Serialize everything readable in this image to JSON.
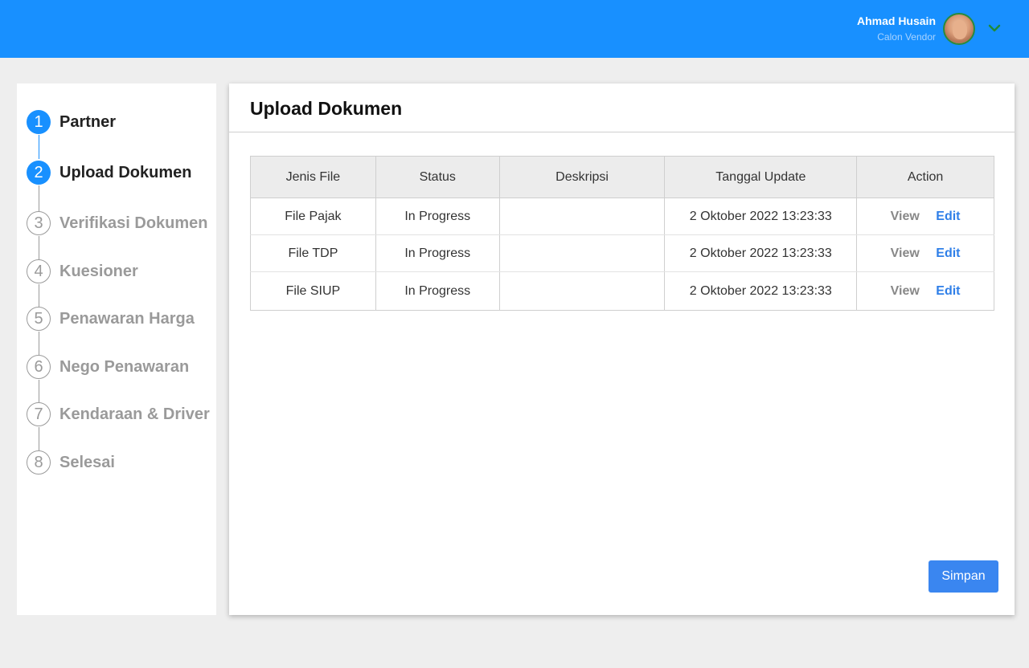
{
  "header": {
    "user_name": "Ahmad Husain",
    "user_role": "Calon Vendor",
    "colors": {
      "bar": "#1890ff"
    }
  },
  "steps": [
    {
      "number": "1",
      "label": "Partner",
      "state": "active"
    },
    {
      "number": "2",
      "label": "Upload Dokumen",
      "state": "active"
    },
    {
      "number": "3",
      "label": "Verifikasi Dokumen",
      "state": "inactive"
    },
    {
      "number": "4",
      "label": "Kuesioner",
      "state": "inactive"
    },
    {
      "number": "5",
      "label": "Penawaran Harga",
      "state": "inactive"
    },
    {
      "number": "6",
      "label": "Nego Penawaran",
      "state": "inactive"
    },
    {
      "number": "7",
      "label": "Kendaraan & Driver",
      "state": "inactive"
    },
    {
      "number": "8",
      "label": "Selesai",
      "state": "inactive"
    }
  ],
  "main": {
    "title": "Upload Dokumen",
    "table": {
      "headers": [
        "Jenis File",
        "Status",
        "Deskripsi",
        "Tanggal Update",
        "Action"
      ],
      "rows": [
        {
          "jenis": "File Pajak",
          "status": "In Progress",
          "deskripsi": "",
          "tanggal": "2 Oktober 2022 13:23:33"
        },
        {
          "jenis": "File TDP",
          "status": "In Progress",
          "deskripsi": "",
          "tanggal": "2 Oktober 2022 13:23:33"
        },
        {
          "jenis": "File SIUP",
          "status": "In Progress",
          "deskripsi": "",
          "tanggal": "2 Oktober 2022 13:23:33"
        }
      ],
      "actions": {
        "view": "View",
        "edit": "Edit"
      }
    },
    "save_label": "Simpan"
  }
}
